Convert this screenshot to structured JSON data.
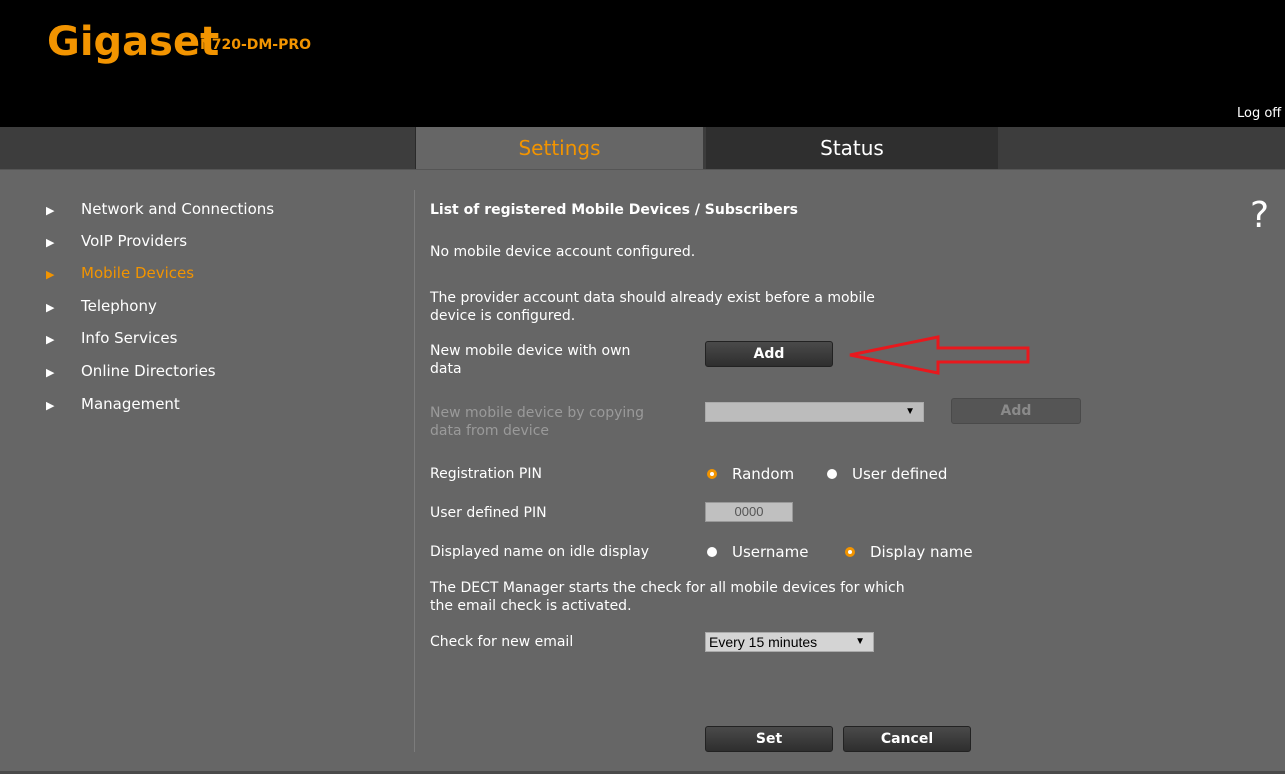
{
  "header": {
    "brand": "Gigaset",
    "model": "N720-DM-PRO",
    "logoff": "Log off"
  },
  "tabs": [
    {
      "label": "Settings",
      "active": true
    },
    {
      "label": "Status",
      "active": false
    }
  ],
  "sidebar": {
    "items": [
      {
        "label": "Network and Connections",
        "active": false
      },
      {
        "label": "VoIP Providers",
        "active": false
      },
      {
        "label": "Mobile Devices",
        "active": true
      },
      {
        "label": "Telephony",
        "active": false
      },
      {
        "label": "Info Services",
        "active": false
      },
      {
        "label": "Online Directories",
        "active": false
      },
      {
        "label": "Management",
        "active": false
      }
    ]
  },
  "main": {
    "title": "List of registered Mobile Devices / Subscribers",
    "no_device": "No mobile device account configured.",
    "provider_note_1": "The provider account data should already exist before a mobile",
    "provider_note_2": "device is configured.",
    "new_own_label_1": "New mobile device with own",
    "new_own_label_2": "data",
    "add_label": "Add",
    "copy_label_1": "New mobile device by copying",
    "copy_label_2": "data from device",
    "copy_select_value": "",
    "copy_add_label": "Add",
    "reg_pin_label": "Registration PIN",
    "reg_pin_options": [
      "Random",
      "User defined"
    ],
    "reg_pin_selected": "Random",
    "user_pin_label": "User defined PIN",
    "user_pin_value": "0000",
    "idle_label": "Displayed name on idle display",
    "idle_options": [
      "Username",
      "Display name"
    ],
    "idle_selected": "Display name",
    "email_note_1": "The DECT Manager starts the check for all mobile devices for which",
    "email_note_2": "the email check is activated.",
    "email_label": "Check for new email",
    "email_value": "Every 15 minutes",
    "set_label": "Set",
    "cancel_label": "Cancel"
  },
  "help_symbol": "?",
  "colors": {
    "accent": "#f29400",
    "background": "#666666",
    "header": "#000000",
    "annotation_arrow": "#e8181d"
  },
  "icons": [
    "triangle-right-icon",
    "help-icon",
    "dropdown-caret-icon",
    "red-arrow-annotation"
  ]
}
